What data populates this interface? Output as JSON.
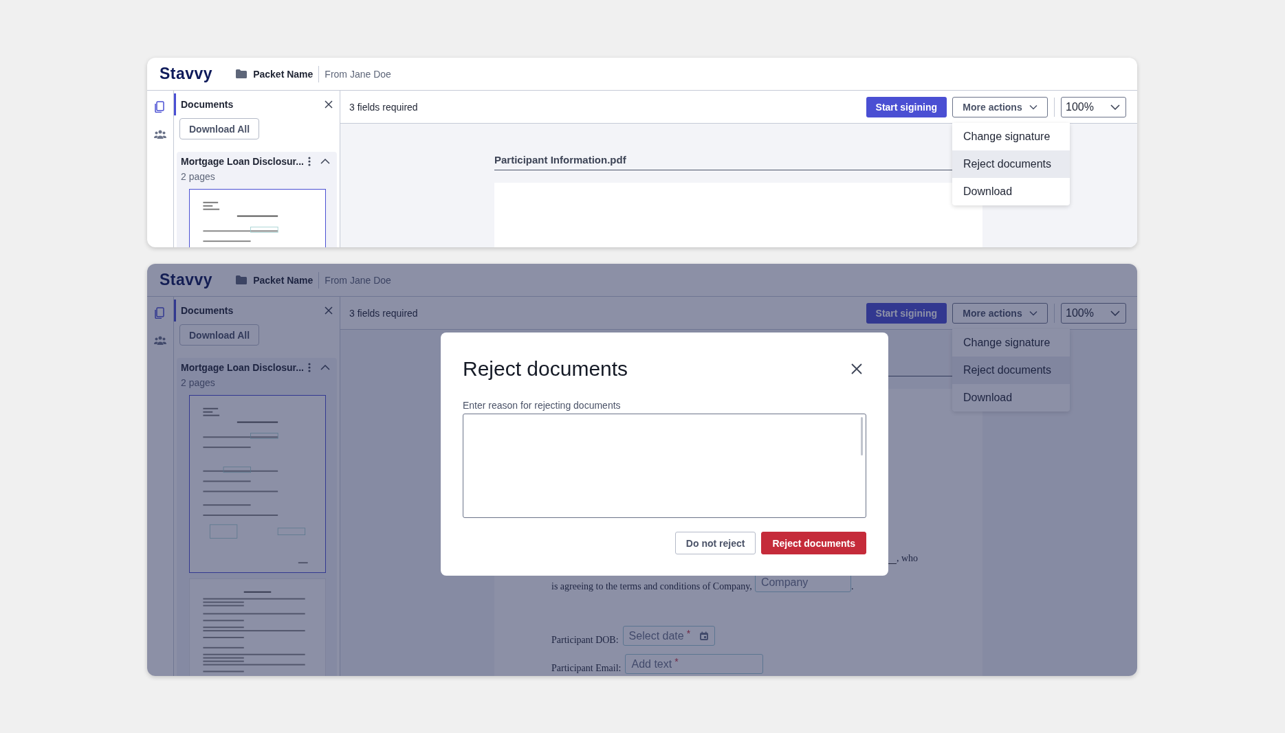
{
  "screens": [
    {
      "header": {
        "logo": "Stavvy",
        "packet_name": "Packet Name",
        "sender": "From Jane Doe"
      },
      "rail": [
        {
          "kind": "documents",
          "selected": true
        },
        {
          "kind": "participants",
          "selected": false
        }
      ],
      "sidebar": {
        "title": "Documents",
        "download_button": "Download All",
        "documents": [
          {
            "name": "Mortgage Loan Disclosur...",
            "pages": "2 pages",
            "expanded": true,
            "thumbnails": [
              {
                "selected": true
              }
            ]
          }
        ]
      },
      "toolbar": {
        "status": "3 fields required",
        "primary_button": "Start sigining",
        "more_button": "More actions",
        "zoom": "100%"
      },
      "menu": {
        "items": [
          {
            "label": "Change signature",
            "highlighted": false
          },
          {
            "label": "Reject documents",
            "highlighted": true
          },
          {
            "label": "Download",
            "highlighted": false
          }
        ]
      },
      "document": {
        "title": "Participant Information.pdf"
      }
    },
    {
      "header": {
        "logo": "Stavvy",
        "packet_name": "Packet Name",
        "sender": "From Jane Doe"
      },
      "rail": [
        {
          "kind": "documents",
          "selected": true
        },
        {
          "kind": "participants",
          "selected": false
        }
      ],
      "sidebar": {
        "title": "Documents",
        "download_button": "Download All",
        "documents": [
          {
            "name": "Mortgage Loan Disclosur...",
            "pages": "2 pages",
            "expanded": true,
            "thumbnails": [
              {
                "selected": true
              },
              {
                "selected": false
              }
            ]
          }
        ]
      },
      "toolbar": {
        "status": "3 fields required",
        "primary_button": "Start sigining",
        "more_button": "More actions",
        "zoom": "100%"
      },
      "menu": {
        "items": [
          {
            "label": "Change signature",
            "highlighted": false
          },
          {
            "label": "Reject documents",
            "highlighted": true
          },
          {
            "label": "Download",
            "highlighted": false
          }
        ]
      },
      "document": {
        "lines": [
          {
            "kind": "trailing",
            "text": ", who"
          },
          {
            "kind": "sentence",
            "text": "is agreeing to the terms and conditions of Company,",
            "field": {
              "placeholder": "Company"
            },
            "end": "."
          },
          {
            "kind": "date",
            "label": "Participant DOB:",
            "field": {
              "placeholder": "Select date",
              "required_mark": "*"
            }
          },
          {
            "kind": "text",
            "label": "Participant Email:",
            "field": {
              "placeholder": "Add text",
              "required_mark": "*"
            }
          }
        ]
      },
      "modal": {
        "title": "Reject documents",
        "field_label": "Enter reason for rejecting documents",
        "buttons": [
          {
            "label": "Do not reject",
            "kind": "secondary"
          },
          {
            "label": "Reject documents",
            "kind": "danger"
          }
        ]
      }
    }
  ]
}
